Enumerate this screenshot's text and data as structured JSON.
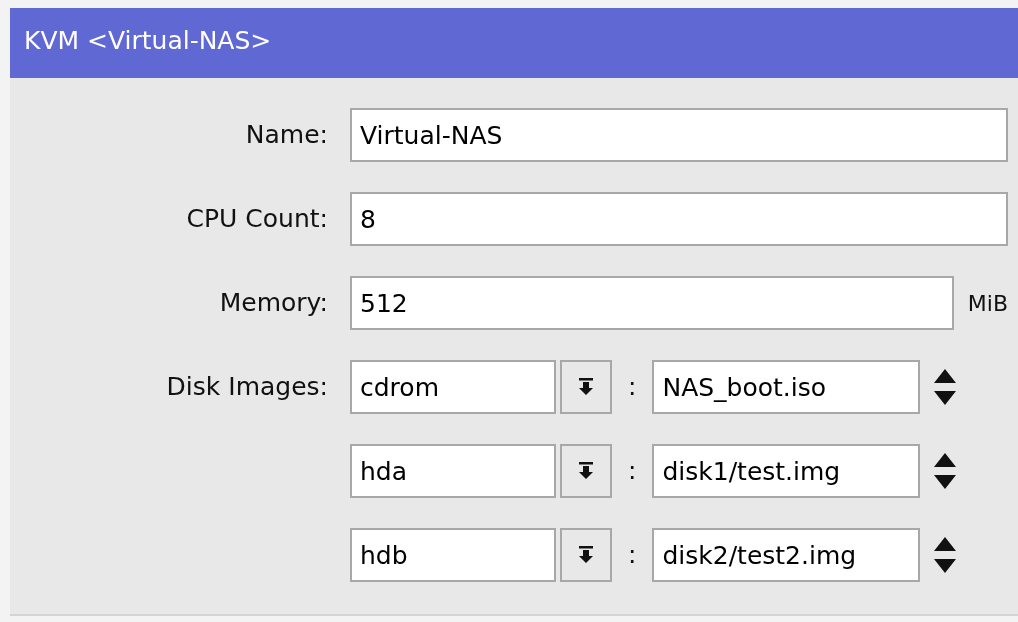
{
  "window": {
    "title": "KVM <Virtual-NAS>"
  },
  "fields": [
    {
      "label": "Name:",
      "value": "Virtual-NAS"
    },
    {
      "label": "CPU Count:",
      "value": "8"
    },
    {
      "label": "Memory:",
      "value": "512",
      "unit": "MiB"
    }
  ],
  "disk_images": {
    "label": "Disk Images:",
    "separator": ":",
    "rows": [
      {
        "device": "cdrom",
        "file": "NAS_boot.iso"
      },
      {
        "device": "hda",
        "file": "disk1/test.img"
      },
      {
        "device": "hdb",
        "file": "disk2/test2.img"
      }
    ]
  }
}
